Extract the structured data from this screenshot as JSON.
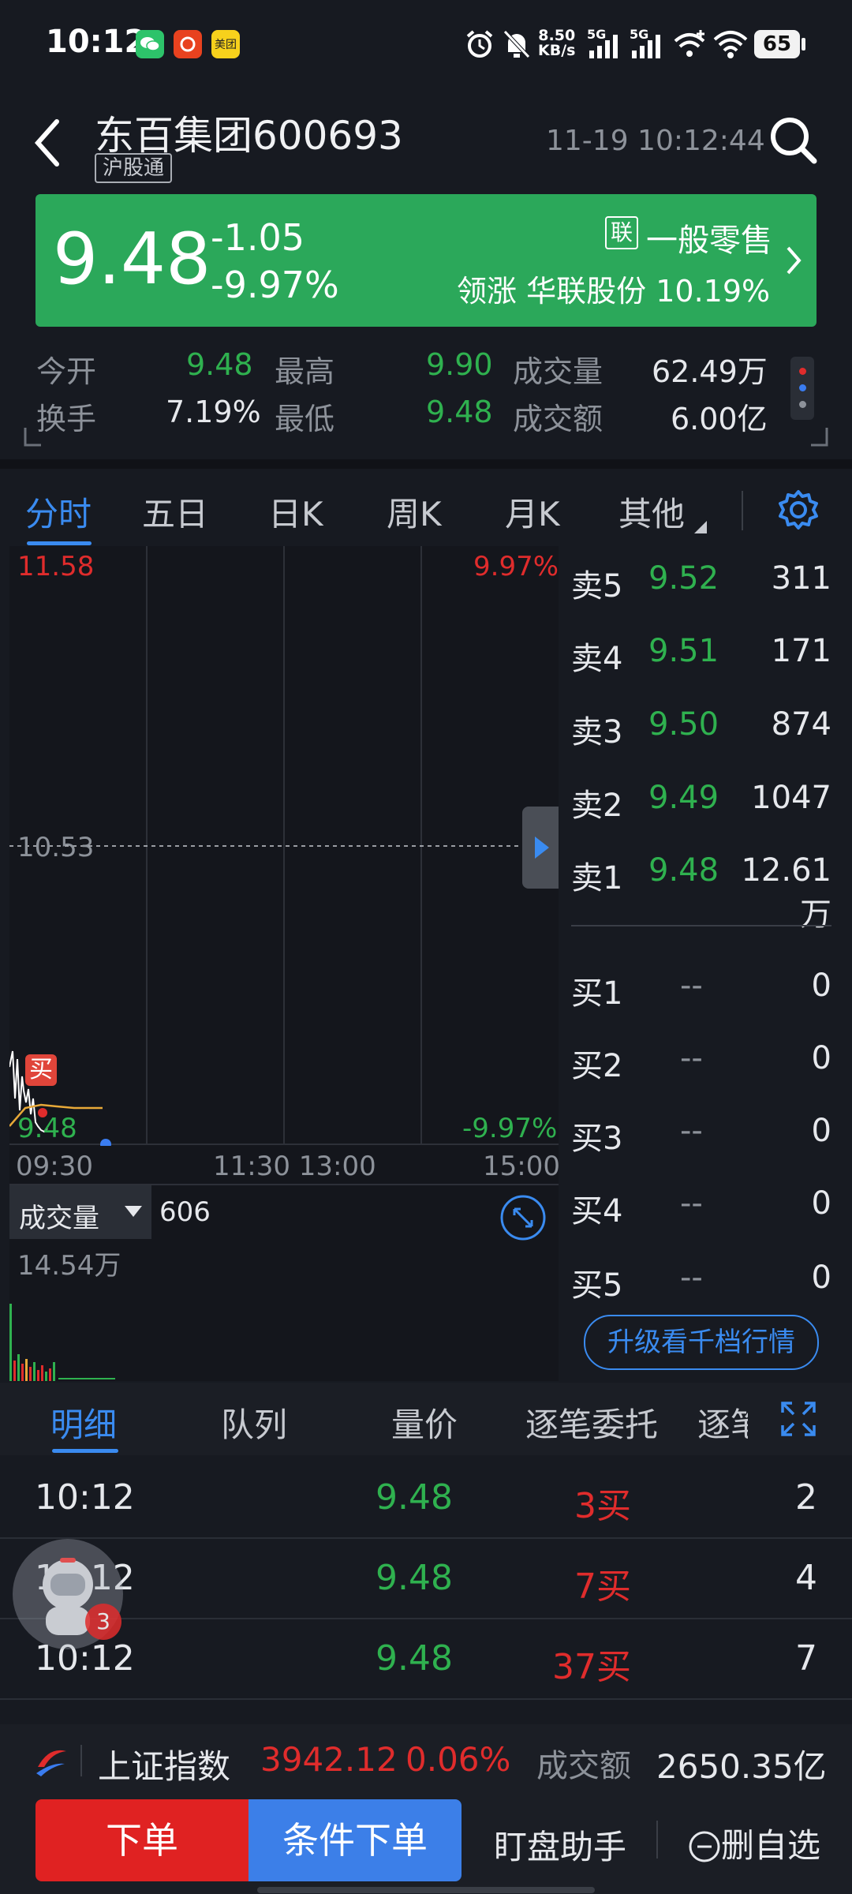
{
  "status_bar": {
    "time": "10:12",
    "net_speed_top": "8.50",
    "net_speed_unit": "KB/s",
    "signal_1": "5G",
    "signal_2": "5G",
    "battery": "65",
    "app_icons": [
      "wechat-icon",
      "pinduoduo-icon",
      "meituan-icon"
    ],
    "meituan_label": "美团"
  },
  "header": {
    "stock_name": "东百集团",
    "stock_code": "600693",
    "badge": "沪股通",
    "datetime": "11-19 10:12:44"
  },
  "price_card": {
    "price": "9.48",
    "change": "-1.05",
    "change_pct": "-9.97%",
    "sector_badge": "联",
    "sector_name": "一般零售",
    "leader_label": "领涨",
    "leader_name": "华联股份",
    "leader_pct": "10.19%",
    "bg_color": "#2ba85a"
  },
  "stats": {
    "open_label": "今开",
    "open_value": "9.48",
    "high_label": "最高",
    "high_value": "9.90",
    "volume_label": "成交量",
    "volume_value": "62.49万",
    "turnover_label": "换手",
    "turnover_value": "7.19%",
    "low_label": "最低",
    "low_value": "9.48",
    "amount_label": "成交额",
    "amount_value": "6.00亿"
  },
  "tabs": [
    "分时",
    "五日",
    "日K",
    "周K",
    "月K",
    "其他"
  ],
  "active_tab": "分时",
  "chart": {
    "top_price": "11.58",
    "top_pct": "9.97%",
    "mid_price": "10.53",
    "bottom_price": "9.48",
    "bottom_pct": "-9.97%",
    "buy_marker": "买",
    "time_labels": [
      "09:30",
      "11:30 13:00",
      "15:00"
    ],
    "volume_label": "成交量",
    "volume_value": "606",
    "volume_max": "14.54万"
  },
  "order_book": {
    "asks": [
      {
        "label": "卖5",
        "price": "9.52",
        "qty": "311"
      },
      {
        "label": "卖4",
        "price": "9.51",
        "qty": "171"
      },
      {
        "label": "卖3",
        "price": "9.50",
        "qty": "874"
      },
      {
        "label": "卖2",
        "price": "9.49",
        "qty": "1047"
      },
      {
        "label": "卖1",
        "price": "9.48",
        "qty": "12.61万"
      }
    ],
    "bids": [
      {
        "label": "买1",
        "price": "--",
        "qty": "0"
      },
      {
        "label": "买2",
        "price": "--",
        "qty": "0"
      },
      {
        "label": "买3",
        "price": "--",
        "qty": "0"
      },
      {
        "label": "买4",
        "price": "--",
        "qty": "0"
      },
      {
        "label": "买5",
        "price": "--",
        "qty": "0"
      }
    ],
    "upgrade_button": "升级看千档行情"
  },
  "detail_tabs": [
    "明细",
    "队列",
    "量价",
    "逐笔委托",
    "逐笔"
  ],
  "active_detail_tab": "明细",
  "detail_rows": [
    {
      "time": "10:12",
      "price": "9.48",
      "vol": "3买",
      "count": "2"
    },
    {
      "time": "10:12",
      "price": "9.48",
      "vol": "7买",
      "count": "4"
    },
    {
      "time": "10:12",
      "price": "9.48",
      "vol": "37买",
      "count": "7"
    }
  ],
  "floating_badge": "3",
  "index_bar": {
    "name": "上证指数",
    "value": "3942.12",
    "pct": "0.06%",
    "amount_label": "成交额",
    "amount_value": "2650.35亿"
  },
  "actions": {
    "order": "下单",
    "conditional_order": "条件下单",
    "assistant": "盯盘助手",
    "remove_watch": "删自选"
  }
}
